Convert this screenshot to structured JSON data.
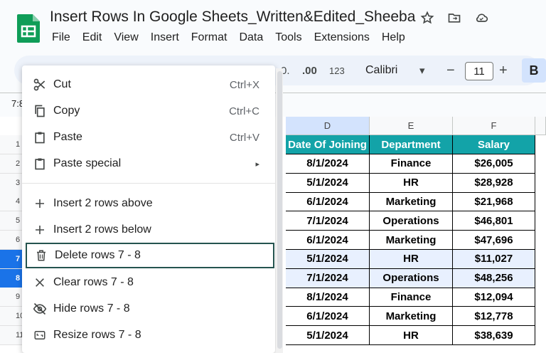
{
  "app": {
    "doc_title": "Insert Rows In Google Sheets_Written&Edited_Sheeba",
    "menus": [
      "File",
      "Edit",
      "View",
      "Insert",
      "Format",
      "Data",
      "Tools",
      "Extensions",
      "Help"
    ]
  },
  "toolbar": {
    "decimal_dec": "0.",
    "decimal_inc": ".00",
    "format_123": "123",
    "font_name": "Calibri",
    "minus": "−",
    "font_size": "11",
    "plus": "+",
    "bold": "B"
  },
  "name_box": "7:8",
  "columns": [
    "D",
    "E",
    "F"
  ],
  "row_numbers": [
    "1",
    "2",
    "3",
    "4",
    "5",
    "6",
    "7",
    "8",
    "9",
    "10",
    "11"
  ],
  "table": {
    "headers": [
      "Date Of Joining",
      "Department",
      "Salary"
    ],
    "rows": [
      [
        "8/1/2024",
        "Finance",
        "$26,005"
      ],
      [
        "5/1/2024",
        "HR",
        "$28,928"
      ],
      [
        "6/1/2024",
        "Marketing",
        "$21,968"
      ],
      [
        "7/1/2024",
        "Operations",
        "$46,801"
      ],
      [
        "6/1/2024",
        "Marketing",
        "$47,696"
      ],
      [
        "5/1/2024",
        "HR",
        "$11,027"
      ],
      [
        "7/1/2024",
        "Operations",
        "$48,256"
      ],
      [
        "8/1/2024",
        "Finance",
        "$12,094"
      ],
      [
        "6/1/2024",
        "Marketing",
        "$12,778"
      ],
      [
        "5/1/2024",
        "HR",
        "$38,639"
      ]
    ]
  },
  "context_menu": {
    "items": [
      {
        "label": "Cut",
        "shortcut": "Ctrl+X",
        "icon": "scissors-icon"
      },
      {
        "label": "Copy",
        "shortcut": "Ctrl+C",
        "icon": "copy-icon"
      },
      {
        "label": "Paste",
        "shortcut": "Ctrl+V",
        "icon": "clipboard-icon"
      },
      {
        "label": "Paste special",
        "shortcut": "▸",
        "icon": "clipboard-icon"
      },
      {
        "label": "Insert 2 rows above",
        "shortcut": "",
        "icon": "plus-icon"
      },
      {
        "label": "Insert 2 rows below",
        "shortcut": "",
        "icon": "plus-icon"
      },
      {
        "label": "Delete rows 7 - 8",
        "shortcut": "",
        "icon": "trash-icon"
      },
      {
        "label": "Clear rows 7 - 8",
        "shortcut": "",
        "icon": "close-icon"
      },
      {
        "label": "Hide rows 7 - 8",
        "shortcut": "",
        "icon": "eye-off-icon"
      },
      {
        "label": "Resize rows 7 - 8",
        "shortcut": "",
        "icon": "resize-icon"
      }
    ]
  },
  "colors": {
    "header_fill": "#13a3a8",
    "selection": "#1a73e8",
    "highlight_border": "#25544f"
  }
}
